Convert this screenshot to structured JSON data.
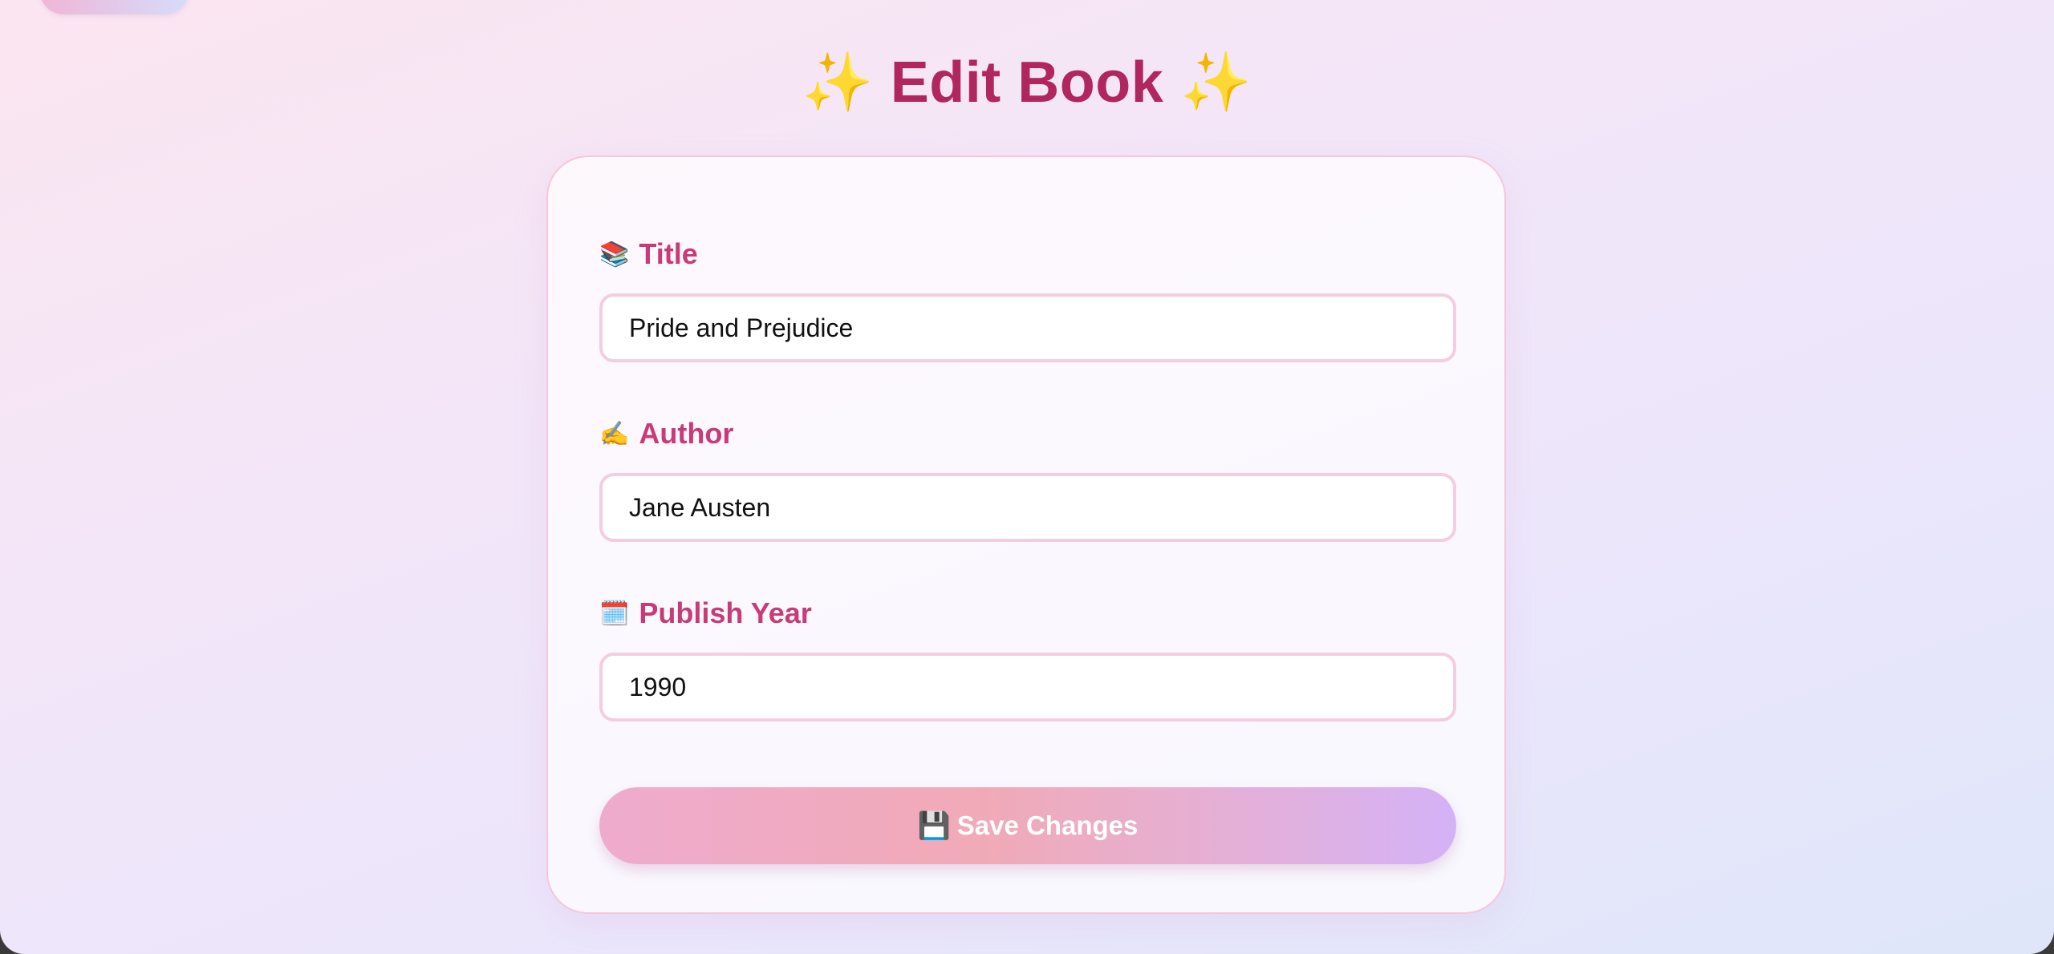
{
  "header": {
    "title": "Edit Book",
    "sparkle_left": "✨",
    "sparkle_right": "✨"
  },
  "form": {
    "fields": [
      {
        "emoji": "📚",
        "label": "Title",
        "value": "Pride and Prejudice"
      },
      {
        "emoji": "✍️",
        "label": "Author",
        "value": "Jane Austen"
      },
      {
        "emoji": "🗓️",
        "label": "Publish Year",
        "value": "1990"
      }
    ],
    "save_button": {
      "emoji": "💾",
      "label": "Save Changes"
    }
  },
  "colors": {
    "title": "#b0275f",
    "label": "#c83a78",
    "input_border": "#f4cde0",
    "button_gradient_start": "#efabcd",
    "button_gradient_end": "#d4b2f7"
  }
}
